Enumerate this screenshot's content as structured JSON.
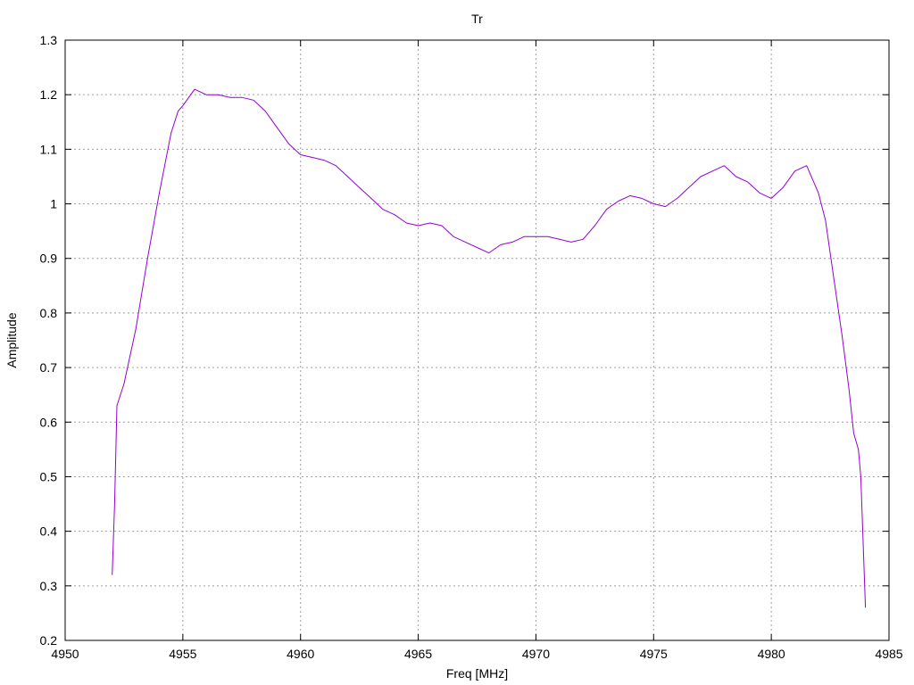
{
  "chart_data": {
    "type": "line",
    "title": "Tr",
    "xlabel": "Freq [MHz]",
    "ylabel": "Amplitude",
    "xlim": [
      4950,
      4985
    ],
    "ylim": [
      0.2,
      1.3
    ],
    "grid": true,
    "legend": "none",
    "x_ticks": [
      4950,
      4955,
      4960,
      4965,
      4970,
      4975,
      4980,
      4985
    ],
    "x_tick_labels": [
      "4950",
      "4955",
      "4960",
      "4965",
      "4970",
      "4975",
      "4980",
      "4985"
    ],
    "y_ticks": [
      0.2,
      0.3,
      0.4,
      0.5,
      0.6,
      0.7,
      0.8,
      0.9,
      1.0,
      1.1,
      1.2,
      1.3
    ],
    "y_tick_labels": [
      "0.2",
      "0.3",
      "0.4",
      "0.5",
      "0.6",
      "0.7",
      "0.8",
      "0.9",
      "1",
      "1.1",
      "1.2",
      "1.3"
    ],
    "series": [
      {
        "color": "#9400d3",
        "x": [
          4952.0,
          4952.1,
          4952.2,
          4952.5,
          4953.0,
          4953.5,
          4954.0,
          4954.5,
          4954.8,
          4955.0,
          4955.5,
          4956.0,
          4956.5,
          4957.0,
          4957.5,
          4958.0,
          4958.5,
          4959.0,
          4959.5,
          4960.0,
          4960.5,
          4961.0,
          4961.5,
          4962.0,
          4962.5,
          4963.0,
          4963.5,
          4964.0,
          4964.5,
          4965.0,
          4965.5,
          4966.0,
          4966.5,
          4967.0,
          4967.5,
          4968.0,
          4968.5,
          4969.0,
          4969.5,
          4970.0,
          4970.5,
          4971.0,
          4971.5,
          4972.0,
          4972.5,
          4973.0,
          4973.5,
          4974.0,
          4974.5,
          4975.0,
          4975.5,
          4976.0,
          4976.5,
          4977.0,
          4977.5,
          4978.0,
          4978.5,
          4979.0,
          4979.5,
          4980.0,
          4980.5,
          4981.0,
          4981.5,
          4982.0,
          4982.3,
          4982.6,
          4983.0,
          4983.3,
          4983.5,
          4983.7,
          4983.8,
          4983.9,
          4984.0
        ],
        "y": [
          0.32,
          0.45,
          0.63,
          0.67,
          0.77,
          0.9,
          1.02,
          1.13,
          1.17,
          1.18,
          1.21,
          1.2,
          1.2,
          1.195,
          1.195,
          1.19,
          1.17,
          1.14,
          1.11,
          1.09,
          1.085,
          1.08,
          1.07,
          1.05,
          1.03,
          1.01,
          0.99,
          0.98,
          0.965,
          0.96,
          0.965,
          0.96,
          0.94,
          0.93,
          0.92,
          0.91,
          0.925,
          0.93,
          0.94,
          0.94,
          0.94,
          0.935,
          0.93,
          0.935,
          0.96,
          0.99,
          1.005,
          1.015,
          1.01,
          1.0,
          0.995,
          1.01,
          1.03,
          1.05,
          1.06,
          1.07,
          1.05,
          1.04,
          1.02,
          1.01,
          1.03,
          1.06,
          1.07,
          1.02,
          0.97,
          0.88,
          0.76,
          0.66,
          0.58,
          0.55,
          0.5,
          0.38,
          0.26
        ]
      }
    ]
  }
}
